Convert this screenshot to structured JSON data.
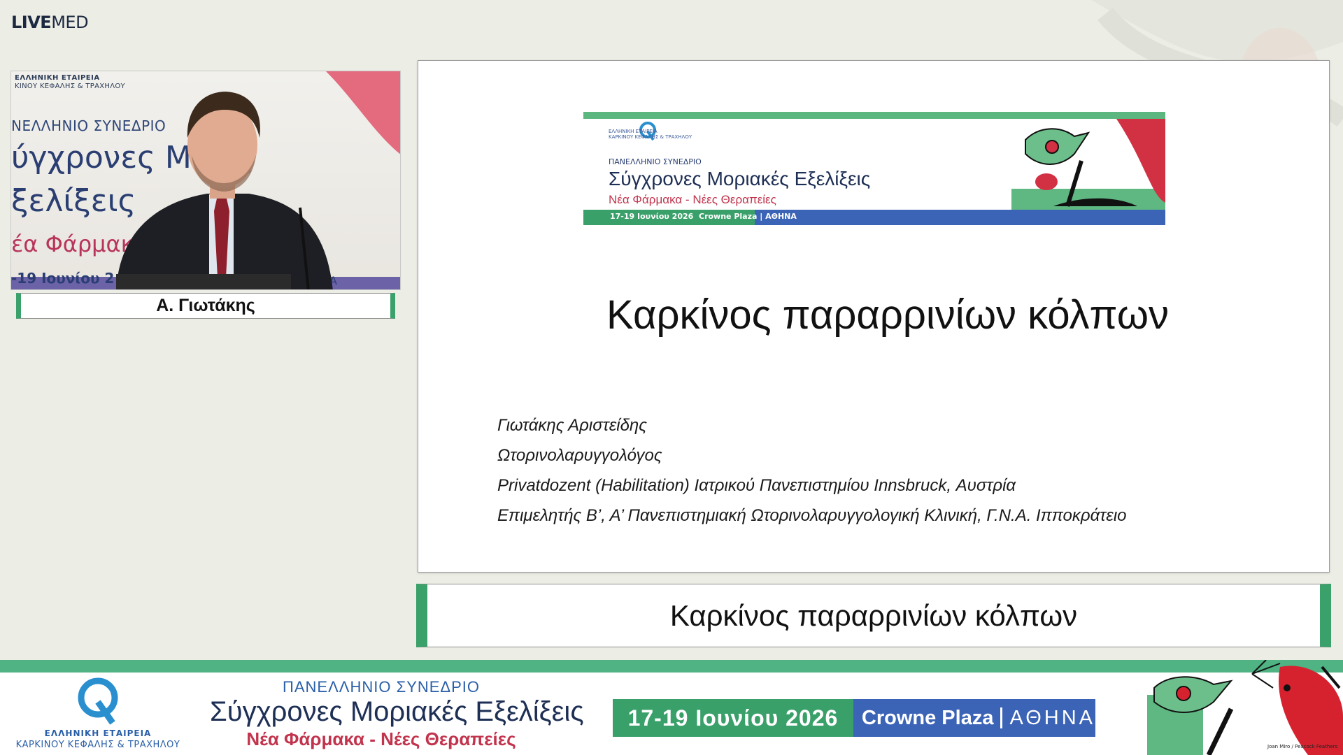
{
  "brand": {
    "bold": "LIVE",
    "light": "MED"
  },
  "video": {
    "backdrop_org_line1": "ΕΛΛΗΝΙΚΗ ΕΤΑΙΡΕΙΑ",
    "backdrop_org_line2": "ΚΙΝΟΥ ΚΕΦΑΛΗΣ & ΤΡΑΧΗΛΟΥ",
    "backdrop_conf": "ΝΕΛΛΗΝΙΟ ΣΥΝΕΔΡΙΟ",
    "backdrop_title1": "ύγχρονες Μ    κές",
    "backdrop_title2": "ξελίξεις",
    "backdrop_sub": "έα Φάρμακ              ς",
    "backdrop_date": "-19 Ιουνίου 2",
    "backdrop_date_right": "Α"
  },
  "speaker": {
    "name": "Α. Γιωτάκης"
  },
  "slide": {
    "banner": {
      "org_line1": "ΕΛΛΗΝΙΚΗ ΕΤΑΙΡΕΙΑ",
      "org_line2": "ΚΑΡΚΙΝΟΥ ΚΕΦΑΛΗΣ & ΤΡΑΧΗΛΟΥ",
      "conference": "ΠΑΝΕΛΛΗΝΙΟ ΣΥΝΕΔΡΙΟ",
      "title": "Σύγχρονες Μοριακές Εξελίξεις",
      "subtitle": "Νέα Φάρμακα - Νέες Θεραπείες",
      "dates": "17-19 Ιουνίου 2026",
      "venue": "Crowne Plaza | ΑΘΗΝΑ"
    },
    "title": "Καρκίνος παραρρινίων κόλπων",
    "lines": [
      "Γιωτάκης Αριστείδης",
      "Ωτορινολαρυγγολόγος",
      "Privatdozent (Habilitation) Ιατρικού Πανεπιστημίου Innsbruck, Αυστρία",
      "Επιμελητής Β’, Α’ Πανεπιστημιακή Ωτορινολαρυγγολογική Κλινική, Γ.Ν.Α. Ιπποκράτειο"
    ]
  },
  "lower_third": {
    "title": "Καρκίνος παραρρινίων κόλπων"
  },
  "footer": {
    "org_line1": "ΕΛΛΗΝΙΚΗ ΕΤΑΙΡΕΙΑ",
    "org_line2": "ΚΑΡΚΙΝΟΥ ΚΕΦΑΛΗΣ & ΤΡΑΧΗΛΟΥ",
    "conference": "ΠΑΝΕΛΛΗΝΙΟ ΣΥΝΕΔΡΙΟ",
    "title": "Σύγχρονες Μοριακές Εξελίξεις",
    "subtitle": "Νέα Φάρμακα - Νέες Θεραπείες",
    "dates": "17-19 Ιουνίου 2026",
    "venue_name": "Crowne Plaza",
    "venue_city": "ΑΘΗΝΑ",
    "art_credit": "Joan Miro / Peacock Feathers"
  },
  "colors": {
    "accent_green": "#3aa16a",
    "accent_blue": "#3b63b6",
    "accent_red": "#c2344d",
    "navy": "#1e2f55"
  }
}
